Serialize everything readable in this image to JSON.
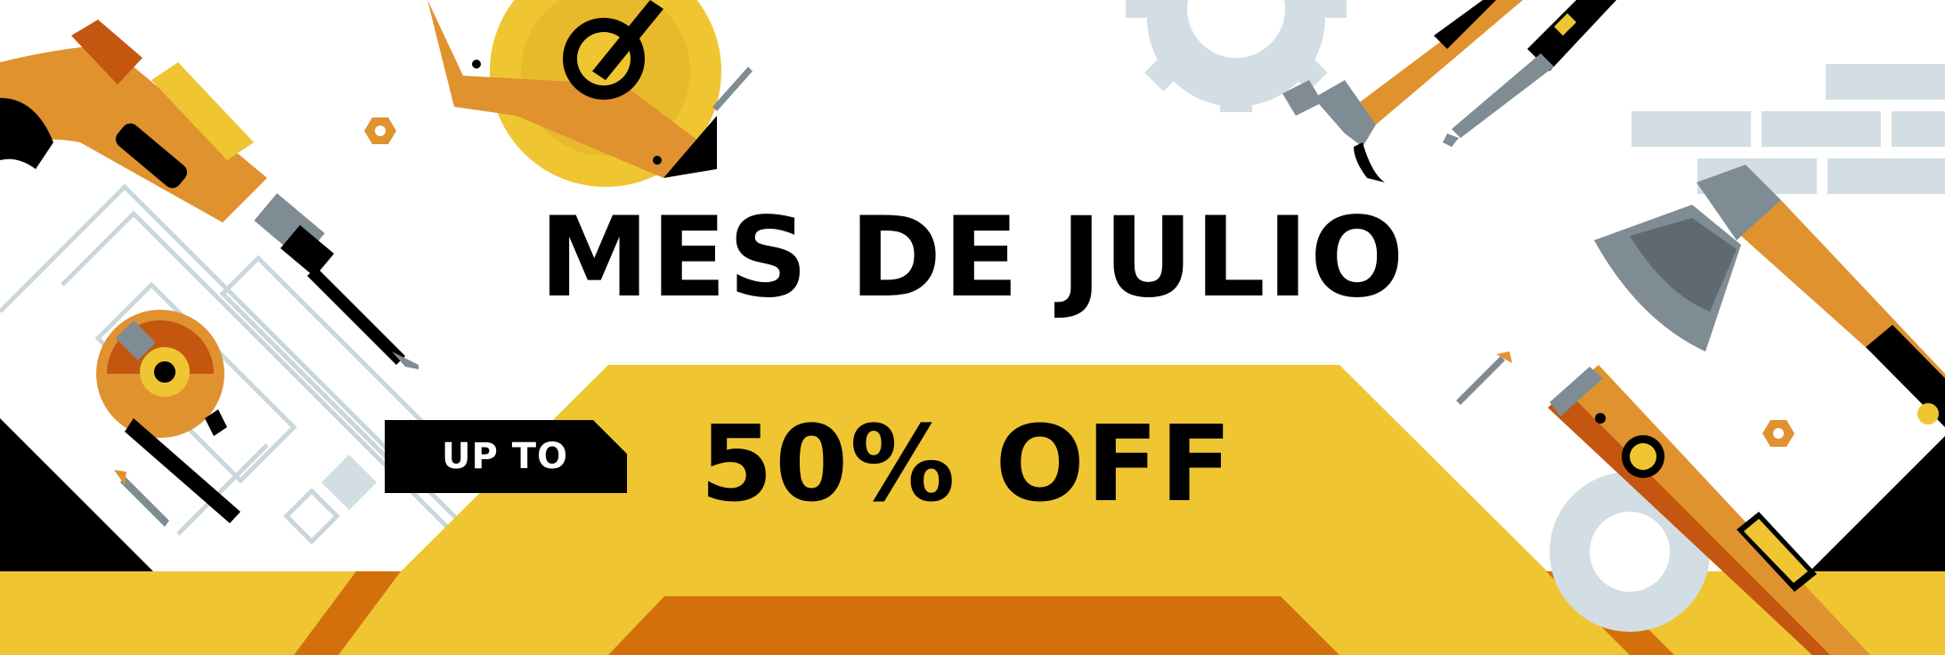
{
  "banner": {
    "headline": "MES DE JULIO",
    "tag_label": "UP TO",
    "offer_text": "50% OFF"
  },
  "colors": {
    "yellow": "#EFC532",
    "orange": "#D4700B",
    "tool_orange": "#E0922F",
    "dark_orange": "#C4560F",
    "black": "#000000",
    "gray": "#7F8C93",
    "light_gray": "#D2DEE3",
    "blueprint": "#C9D6DC"
  },
  "icons": [
    "power-drill-icon",
    "tape-measure-icon",
    "gear-icon",
    "hammer-icon",
    "screwdriver-icon",
    "brick-wall-icon",
    "axe-icon",
    "spirit-level-icon",
    "hex-nut-icon",
    "nail-icon",
    "blueprint-icon",
    "map-pin-icon"
  ]
}
